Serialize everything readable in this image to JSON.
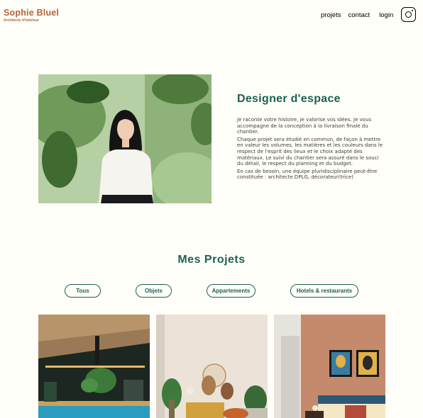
{
  "header": {
    "logo_title": "Sophie Bluel",
    "logo_subtitle": "Architecte d'intérieur",
    "nav": [
      "projets",
      "contact",
      "login"
    ],
    "instagram_icon": "instagram-icon"
  },
  "intro": {
    "title": "Designer d'espace",
    "paragraphs": [
      "Je raconte votre histoire, je valorise vos idées. Je vous accompagne de la conception à la livraison finale du chantier.",
      "Chaque projet sera étudié en commun, de façon à mettre en valeur les volumes, les matières et les couleurs dans le respect de l'esprit des lieux et le choix adapté des matériaux. Le suivi du chantier sera assuré dans le souci du détail, le respect du planning et du budget.",
      "En cas de besoin, une équipe pluridisciplinaire peut-être constituée : architecte DPLG, décorateur(trice)"
    ]
  },
  "projects": {
    "title": "Mes Projets",
    "filters": [
      "Tous",
      "Objets",
      "Appartements",
      "Hotels & restaurants"
    ]
  },
  "colors": {
    "brand": "#b1663c",
    "accent": "#1d6154",
    "background": "#fffef8"
  }
}
